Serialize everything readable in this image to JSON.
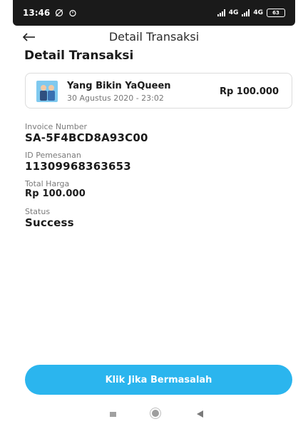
{
  "status_bar": {
    "time": "13:46",
    "network_1": "4G",
    "network_2": "4G",
    "battery": "63"
  },
  "app_bar": {
    "title": "Detail Transaksi"
  },
  "page": {
    "title": "Detail Transaksi"
  },
  "transaction": {
    "name": "Yang Bikin YaQueen",
    "date": "30 Agustus 2020 - 23:02",
    "amount": "Rp 100.000"
  },
  "fields": {
    "invoice": {
      "label": "Invoice Number",
      "value": "SA-5F4BCD8A93C00"
    },
    "order_id": {
      "label": "ID Pemesanan",
      "value": "11309968363653"
    },
    "total": {
      "label": "Total Harga",
      "value": "Rp 100.000"
    },
    "status": {
      "label": "Status",
      "value": "Success"
    }
  },
  "cta": {
    "label": "Klik Jika Bermasalah"
  },
  "colors": {
    "accent": "#2bb5ee",
    "status_bar": "#1a1a1a"
  },
  "icons": [
    "back-arrow-icon",
    "transaction-thumbnail",
    "recent-apps-icon",
    "home-icon",
    "back-icon"
  ]
}
